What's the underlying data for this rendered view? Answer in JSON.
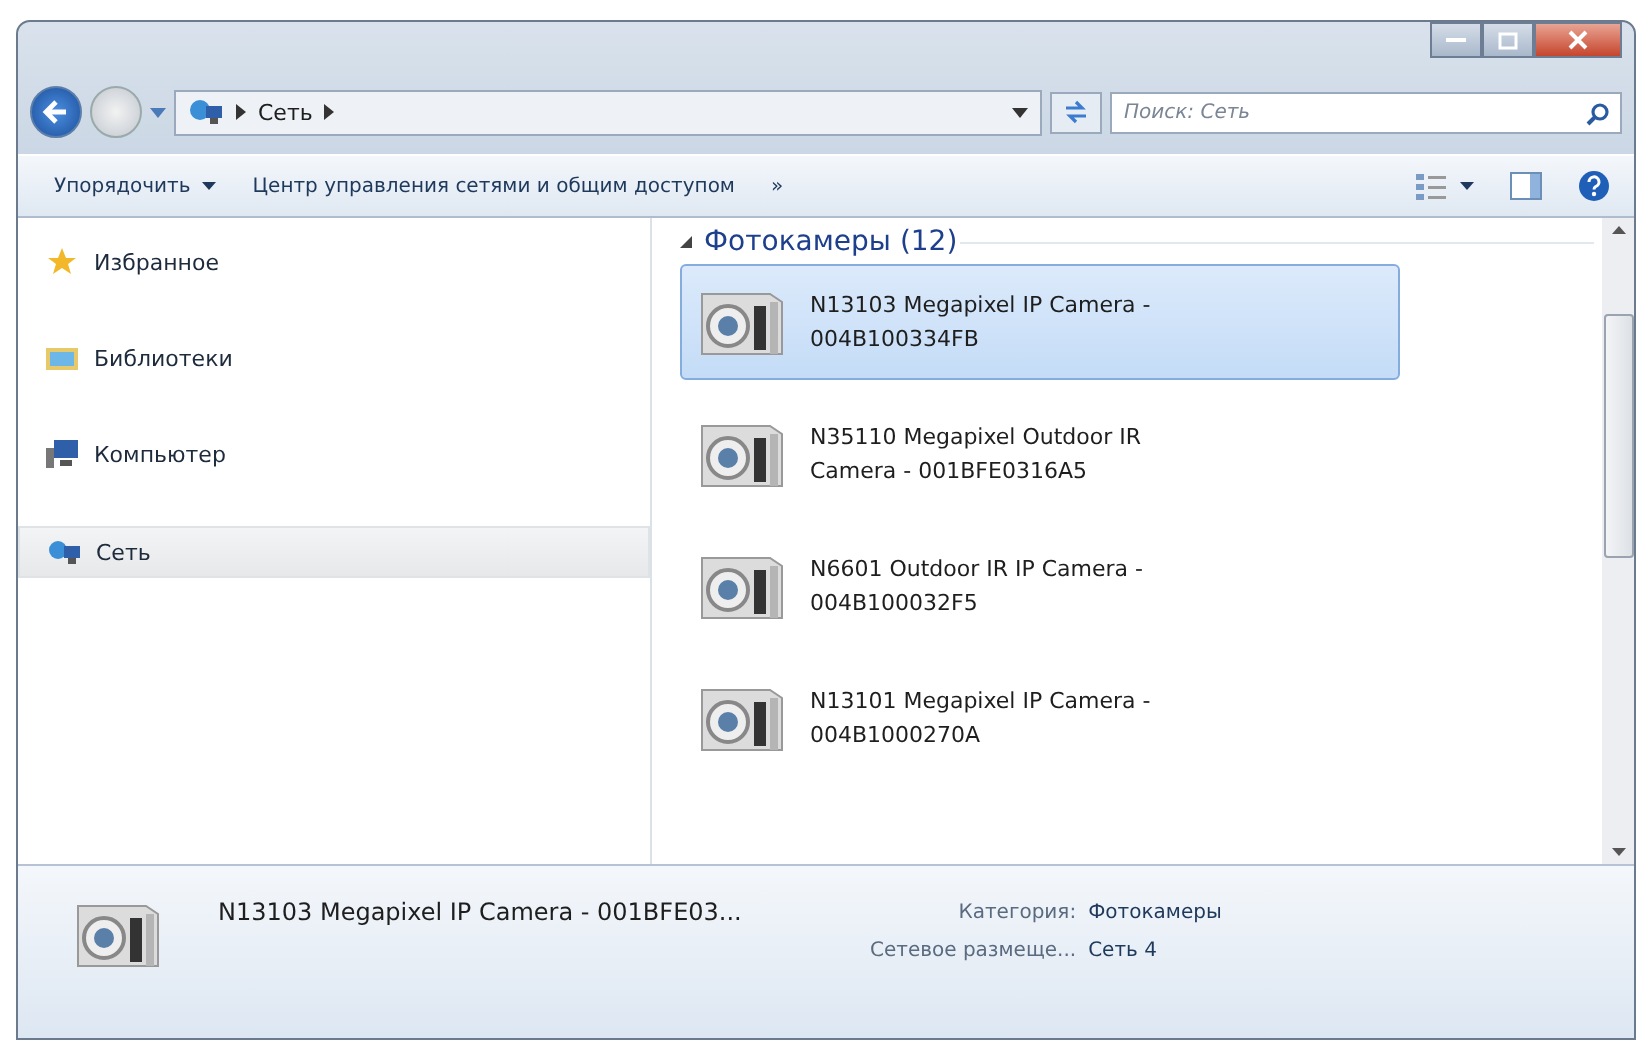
{
  "address": {
    "path": [
      "Сеть"
    ]
  },
  "search": {
    "placeholder": "Поиск: Сеть"
  },
  "toolbar": {
    "items": [
      {
        "label": "Упорядочить",
        "has_menu": true
      },
      {
        "label": "Центр управления сетями и общим доступом",
        "has_menu": false
      }
    ],
    "overflow": "»"
  },
  "sidebar": {
    "items": [
      {
        "label": "Избранное",
        "kind": "favorites",
        "selected": false
      },
      {
        "label": "Библиотеки",
        "kind": "libraries",
        "selected": false
      },
      {
        "label": "Компьютер",
        "kind": "computer",
        "selected": false
      },
      {
        "label": "Сеть",
        "kind": "network",
        "selected": true
      }
    ]
  },
  "group": {
    "title": "Фотокамеры (12)",
    "expanded": true,
    "items": [
      {
        "label": "N13103 Megapixel IP Camera - 004B100334FB",
        "selected": true
      },
      {
        "label": "N35110 Megapixel Outdoor IR Camera - 001BFE0316A5",
        "selected": false
      },
      {
        "label": "N6601 Outdoor IR IP Camera - 004B100032F5",
        "selected": false
      },
      {
        "label": "N13101 Megapixel IP Camera - 004B1000270A",
        "selected": false
      }
    ]
  },
  "details": {
    "name": "N13103 Megapixel IP Camera - 001BFE03...",
    "properties": [
      {
        "label": "Категория:",
        "value": "Фотокамеры"
      },
      {
        "label": "Сетевое размеще...",
        "value": "Сеть 4"
      }
    ]
  }
}
